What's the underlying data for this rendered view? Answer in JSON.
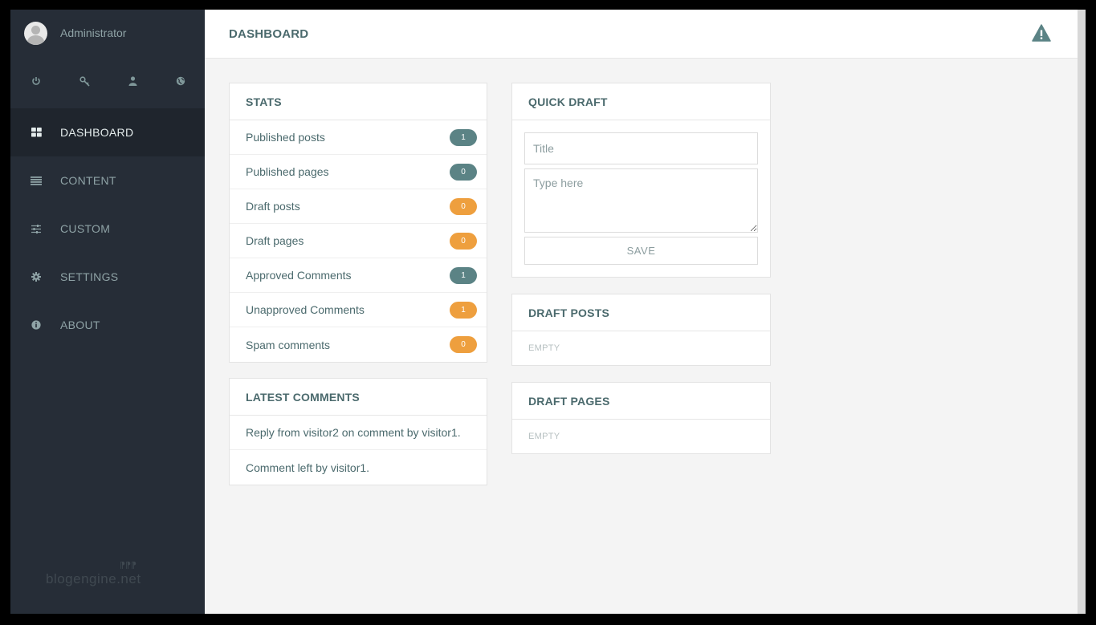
{
  "user": {
    "name": "Administrator"
  },
  "top_icons": [
    "power-icon",
    "key-icon",
    "user-icon",
    "globe-icon"
  ],
  "nav": [
    {
      "label": "DASHBOARD",
      "icon": "grid-icon",
      "active": true
    },
    {
      "label": "CONTENT",
      "icon": "list-icon",
      "active": false
    },
    {
      "label": "CUSTOM",
      "icon": "sliders-icon",
      "active": false
    },
    {
      "label": "SETTINGS",
      "icon": "gear-icon",
      "active": false
    },
    {
      "label": "ABOUT",
      "icon": "info-icon",
      "active": false
    }
  ],
  "header": {
    "title": "DASHBOARD",
    "alert_icon": "warning-icon"
  },
  "stats": {
    "title": "STATS",
    "rows": [
      {
        "label": "Published posts",
        "count": "1",
        "color": "#5b8385"
      },
      {
        "label": "Published pages",
        "count": "0",
        "color": "#5b8385"
      },
      {
        "label": "Draft posts",
        "count": "0",
        "color": "#ee9f3e"
      },
      {
        "label": "Draft pages",
        "count": "0",
        "color": "#ee9f3e"
      },
      {
        "label": "Approved Comments",
        "count": "1",
        "color": "#5b8385"
      },
      {
        "label": "Unapproved Comments",
        "count": "1",
        "color": "#ee9f3e"
      },
      {
        "label": "Spam comments",
        "count": "0",
        "color": "#ee9f3e"
      }
    ]
  },
  "latest_comments": {
    "title": "LATEST COMMENTS",
    "items": [
      "Reply from visitor2 on comment by visitor1.",
      "Comment left by visitor1."
    ]
  },
  "quick_draft": {
    "title": "QUICK DRAFT",
    "title_placeholder": "Title",
    "body_placeholder": "Type here",
    "save_label": "SAVE"
  },
  "draft_posts": {
    "title": "DRAFT POSTS",
    "empty_text": "EMPTY"
  },
  "draft_pages": {
    "title": "DRAFT PAGES",
    "empty_text": "EMPTY"
  },
  "watermark": {
    "text": "blogengine.net"
  }
}
